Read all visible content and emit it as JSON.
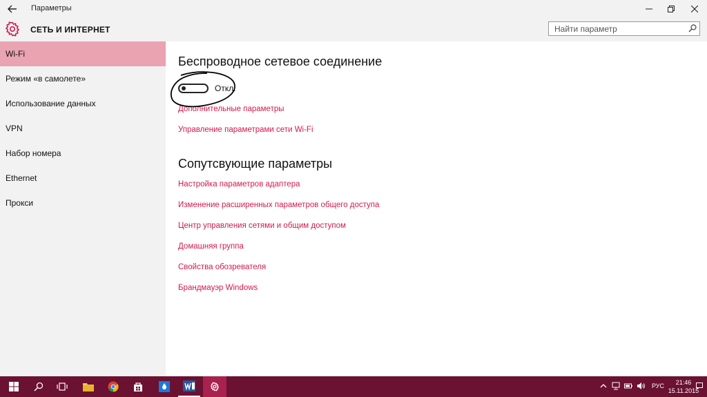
{
  "window": {
    "title": "Параметры"
  },
  "header": {
    "title": "СЕТЬ И ИНТЕРНЕТ",
    "search_placeholder": "Найти параметр"
  },
  "sidebar": {
    "items": [
      {
        "label": "Wi-Fi",
        "active": true
      },
      {
        "label": "Режим «в самолете»",
        "active": false
      },
      {
        "label": "Использование данных",
        "active": false
      },
      {
        "label": "VPN",
        "active": false
      },
      {
        "label": "Набор номера",
        "active": false
      },
      {
        "label": "Ethernet",
        "active": false
      },
      {
        "label": "Прокси",
        "active": false
      }
    ]
  },
  "main": {
    "wireless_title": "Беспроводное сетевое соединение",
    "toggle_state": "Откл.",
    "toggle_on": false,
    "wireless_links": [
      "Дополнительные параметры",
      "Управление параметрами сети Wi-Fi"
    ],
    "related_title": "Сопутсвующие параметры",
    "related_links": [
      "Настройка параметров адаптера",
      "Изменение расширенных параметров общего доступа",
      "Центр управления сетями и общим доступом",
      "Домашняя группа",
      "Свойства обозревателя",
      "Брандмауэр Windows"
    ]
  },
  "taskbar": {
    "lang": "РУС",
    "time": "21:46",
    "date": "15.11.2015"
  },
  "colors": {
    "accent": "#d11a4a",
    "sidebar_active": "#e9a3b1",
    "taskbar": "#6b1131",
    "chrome": "#f2f2f2"
  }
}
